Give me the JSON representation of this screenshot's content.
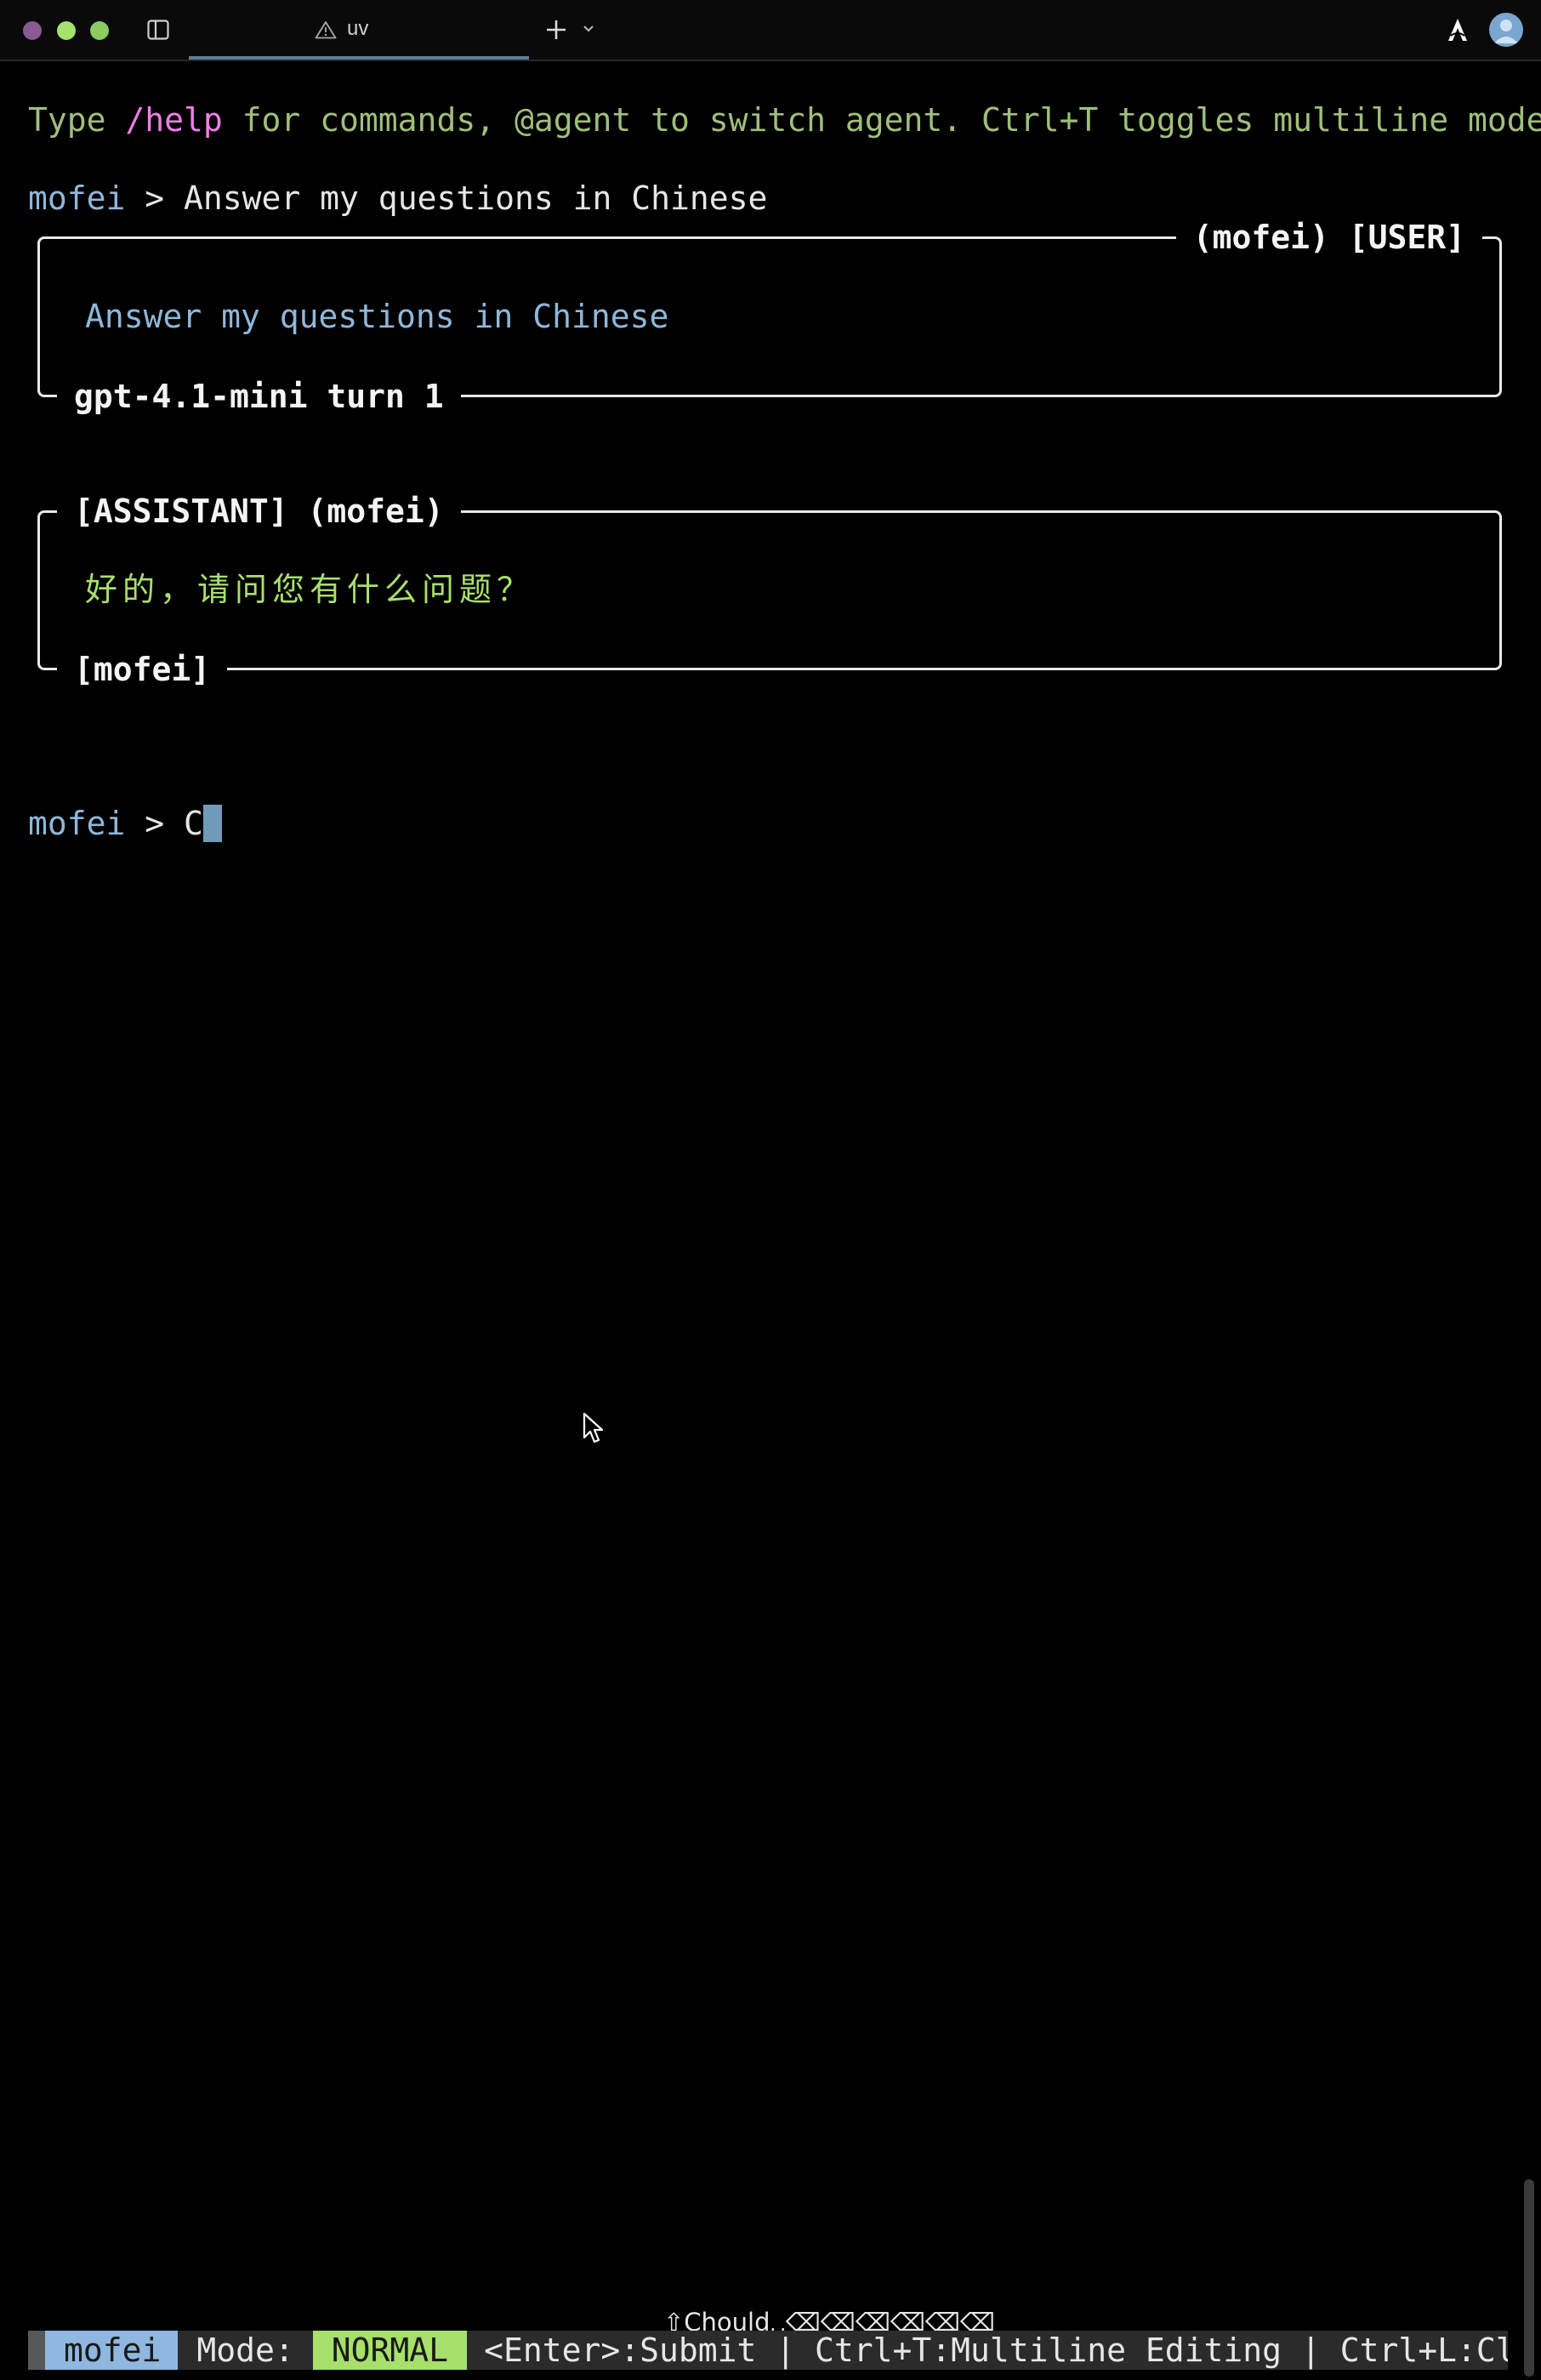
{
  "window": {
    "tab_title": "uv"
  },
  "terminal": {
    "help_line": {
      "prefix": "Type ",
      "command": "/help",
      "suffix": " for commands, @agent to switch agent. Ctrl+T toggles multiline mode."
    },
    "history_prompt": {
      "user": "mofei",
      "arrow": " > ",
      "text": "Answer my questions in Chinese"
    },
    "user_box": {
      "header": "(mofei) [USER]",
      "body": "Answer my questions in Chinese",
      "footer": "gpt-4.1-mini turn 1"
    },
    "assistant_box": {
      "header": "[ASSISTANT] (mofei)",
      "body": "好的，请问您有什么问题？",
      "footer": "[mofei]"
    },
    "current_prompt": {
      "user": "mofei",
      "arrow": " > ",
      "input": "C"
    }
  },
  "status_bar": {
    "keystrokes": "⇧Chould␣⌫⌫⌫⌫⌫⌫",
    "agent": "mofei",
    "mode_label": "Mode:",
    "mode": "NORMAL",
    "hints": "<Enter>:Submit | Ctrl+T:Multiline Editing | Ctrl+L:Clea"
  },
  "colors": {
    "accent_green": "#9fbf7a",
    "accent_pink": "#ef7ee6",
    "accent_blue": "#8fb7da",
    "assistant_text": "#a9e06a",
    "mode_badge": "#a7e06a",
    "agent_badge": "#8fb7e0"
  },
  "icons": [
    "sidebar-toggle-icon",
    "warning-icon",
    "plus-icon",
    "chevron-down-icon",
    "arc-icon",
    "avatar-icon",
    "mouse-pointer-icon"
  ]
}
